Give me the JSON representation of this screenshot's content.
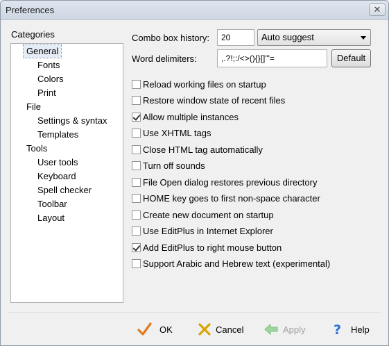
{
  "window": {
    "title": "Preferences",
    "close_glyph": "✕"
  },
  "sidebar": {
    "heading": "Categories",
    "items": [
      {
        "label": "General",
        "selected": true
      },
      {
        "label": "Fonts"
      },
      {
        "label": "Colors"
      },
      {
        "label": "Print"
      },
      {
        "label": "File"
      },
      {
        "label": "Settings & syntax"
      },
      {
        "label": "Templates"
      },
      {
        "label": "Tools"
      },
      {
        "label": "User tools"
      },
      {
        "label": "Keyboard"
      },
      {
        "label": "Spell checker"
      },
      {
        "label": "Toolbar"
      },
      {
        "label": "Layout"
      }
    ]
  },
  "general": {
    "combo_label": "Combo box history:",
    "combo_value": "20",
    "autosuggest_value": "Auto suggest",
    "word_delim_label": "Word delimiters:",
    "word_delim_value": ",.?!;:/<>(){}[]\"'=",
    "default_button": "Default",
    "options": [
      {
        "label": "Reload working files on startup",
        "checked": false
      },
      {
        "label": "Restore window state of recent files",
        "checked": false
      },
      {
        "label": "Allow multiple instances",
        "checked": true
      },
      {
        "label": "Use XHTML tags",
        "checked": false
      },
      {
        "label": "Close HTML tag automatically",
        "checked": false
      },
      {
        "label": "Turn off sounds",
        "checked": false
      },
      {
        "label": "File Open dialog restores previous directory",
        "checked": false
      },
      {
        "label": "HOME key goes to first non-space character",
        "checked": false
      },
      {
        "label": "Create new document on startup",
        "checked": false
      },
      {
        "label": "Use EditPlus in Internet Explorer",
        "checked": false
      },
      {
        "label": "Add EditPlus to right mouse button",
        "checked": true
      },
      {
        "label": "Support Arabic and Hebrew text (experimental)",
        "checked": false
      }
    ]
  },
  "footer": {
    "ok": "OK",
    "cancel": "Cancel",
    "apply": "Apply",
    "help": "Help"
  },
  "colors": {
    "ok_check": "#e07a1f",
    "cancel_x": "#d9a400",
    "apply_arrow": "#9fd49f",
    "help_q": "#2a6fd6"
  }
}
